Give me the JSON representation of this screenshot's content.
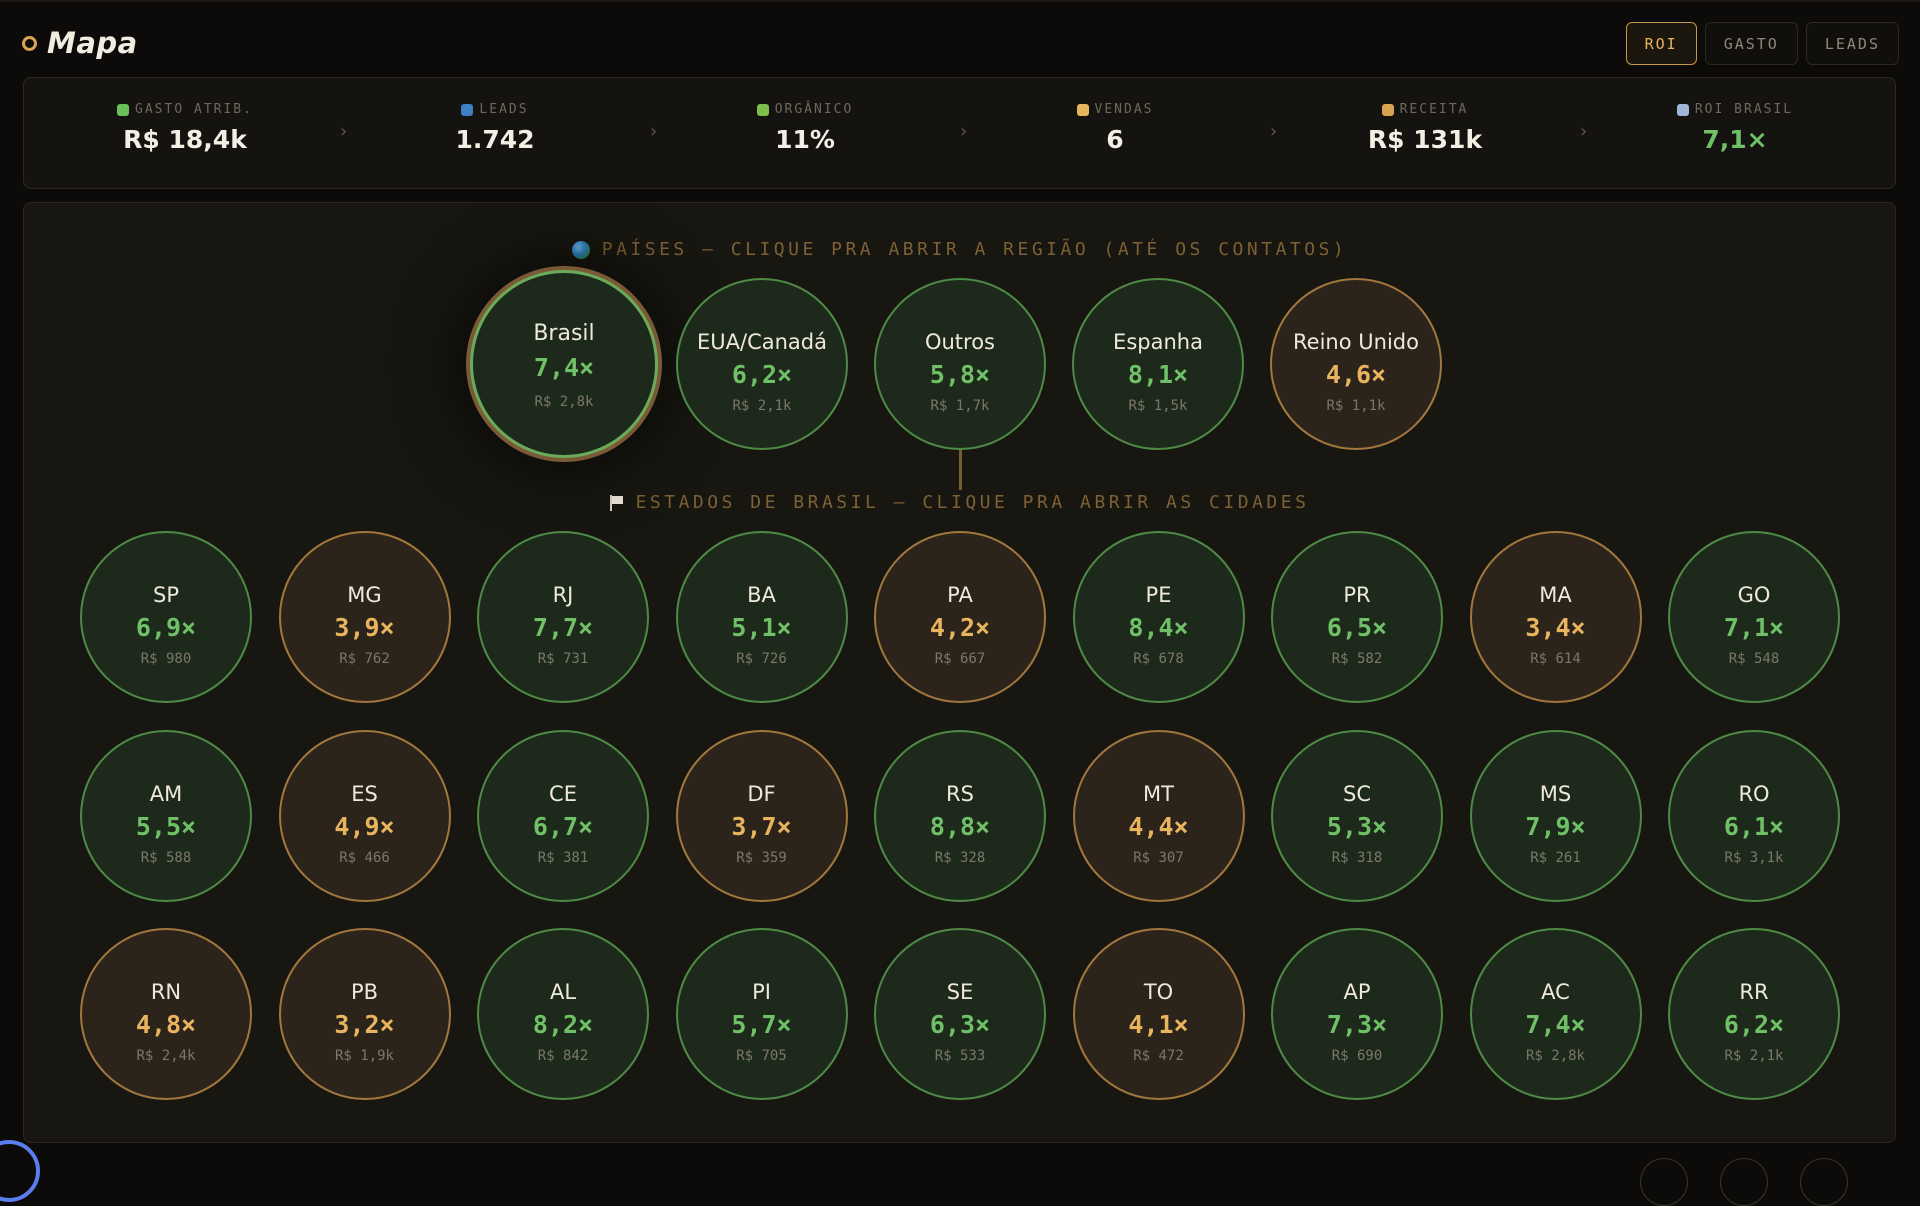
{
  "page": {
    "title": "Mapa"
  },
  "modes": [
    {
      "label": "ROI",
      "active": true
    },
    {
      "label": "GASTO",
      "active": false
    },
    {
      "label": "LEADS",
      "active": false
    }
  ],
  "stats": [
    {
      "label": "GASTO ATRIB.",
      "value": "R$ 18,4k",
      "icon": "leaf-icon",
      "icon_color": "#6bbf5a"
    },
    {
      "label": "LEADS",
      "value": "1.742",
      "icon": "person-icon",
      "icon_color": "#3f7fc4"
    },
    {
      "label": "ORGÂNICO",
      "value": "11%",
      "icon": "seedling-icon",
      "icon_color": "#7dbf4a"
    },
    {
      "label": "VENDAS",
      "value": "6",
      "icon": "handshake-icon",
      "icon_color": "#e8b45e"
    },
    {
      "label": "RECEITA",
      "value": "R$ 131k",
      "icon": "money-bag-icon",
      "icon_color": "#d9a451"
    },
    {
      "label": "ROI BRASIL",
      "value": "7,1×",
      "icon": "chart-up-icon",
      "icon_color": "#9fb6d8",
      "highlight": true
    }
  ],
  "countries_heading": "PAÍSES — CLIQUE PRA ABRIR A REGIÃO (ATÉ OS CONTATOS)",
  "countries": [
    {
      "name": "Brasil",
      "roi": "7,4×",
      "spend": "R$ 2,8k",
      "status": "good",
      "selected": true
    },
    {
      "name": "EUA/Canadá",
      "roi": "6,2×",
      "spend": "R$ 2,1k",
      "status": "good"
    },
    {
      "name": "Outros",
      "roi": "5,8×",
      "spend": "R$ 1,7k",
      "status": "good"
    },
    {
      "name": "Espanha",
      "roi": "8,1×",
      "spend": "R$ 1,5k",
      "status": "good"
    },
    {
      "name": "Reino Unido",
      "roi": "4,6×",
      "spend": "R$ 1,1k",
      "status": "warn"
    }
  ],
  "states_heading": "ESTADOS DE BRASIL — CLIQUE PRA ABRIR AS CIDADES",
  "states": [
    {
      "name": "SP",
      "roi": "6,9×",
      "spend": "R$ 980",
      "status": "good"
    },
    {
      "name": "MG",
      "roi": "3,9×",
      "spend": "R$ 762",
      "status": "warn"
    },
    {
      "name": "RJ",
      "roi": "7,7×",
      "spend": "R$ 731",
      "status": "good"
    },
    {
      "name": "BA",
      "roi": "5,1×",
      "spend": "R$ 726",
      "status": "good"
    },
    {
      "name": "PA",
      "roi": "4,2×",
      "spend": "R$ 667",
      "status": "warn"
    },
    {
      "name": "PE",
      "roi": "8,4×",
      "spend": "R$ 678",
      "status": "good"
    },
    {
      "name": "PR",
      "roi": "6,5×",
      "spend": "R$ 582",
      "status": "good"
    },
    {
      "name": "MA",
      "roi": "3,4×",
      "spend": "R$ 614",
      "status": "warn"
    },
    {
      "name": "GO",
      "roi": "7,1×",
      "spend": "R$ 548",
      "status": "good"
    },
    {
      "name": "AM",
      "roi": "5,5×",
      "spend": "R$ 588",
      "status": "good"
    },
    {
      "name": "ES",
      "roi": "4,9×",
      "spend": "R$ 466",
      "status": "warn"
    },
    {
      "name": "CE",
      "roi": "6,7×",
      "spend": "R$ 381",
      "status": "good"
    },
    {
      "name": "DF",
      "roi": "3,7×",
      "spend": "R$ 359",
      "status": "warn"
    },
    {
      "name": "RS",
      "roi": "8,8×",
      "spend": "R$ 328",
      "status": "good"
    },
    {
      "name": "MT",
      "roi": "4,4×",
      "spend": "R$ 307",
      "status": "warn"
    },
    {
      "name": "SC",
      "roi": "5,3×",
      "spend": "R$ 318",
      "status": "good"
    },
    {
      "name": "MS",
      "roi": "7,9×",
      "spend": "R$ 261",
      "status": "good"
    },
    {
      "name": "RO",
      "roi": "6,1×",
      "spend": "R$ 3,1k",
      "status": "good"
    },
    {
      "name": "RN",
      "roi": "4,8×",
      "spend": "R$ 2,4k",
      "status": "warn"
    },
    {
      "name": "PB",
      "roi": "3,2×",
      "spend": "R$ 1,9k",
      "status": "warn"
    },
    {
      "name": "AL",
      "roi": "8,2×",
      "spend": "R$ 842",
      "status": "good"
    },
    {
      "name": "PI",
      "roi": "5,7×",
      "spend": "R$ 705",
      "status": "good"
    },
    {
      "name": "SE",
      "roi": "6,3×",
      "spend": "R$ 533",
      "status": "good"
    },
    {
      "name": "TO",
      "roi": "4,1×",
      "spend": "R$ 472",
      "status": "warn"
    },
    {
      "name": "AP",
      "roi": "7,3×",
      "spend": "R$ 690",
      "status": "good"
    },
    {
      "name": "AC",
      "roi": "7,4×",
      "spend": "R$ 2,8k",
      "status": "good"
    },
    {
      "name": "RR",
      "roi": "6,2×",
      "spend": "R$ 2,1k",
      "status": "good"
    }
  ],
  "colors": {
    "good": "#6fc067",
    "warn": "#e8b45e",
    "accent": "#d9a451"
  }
}
